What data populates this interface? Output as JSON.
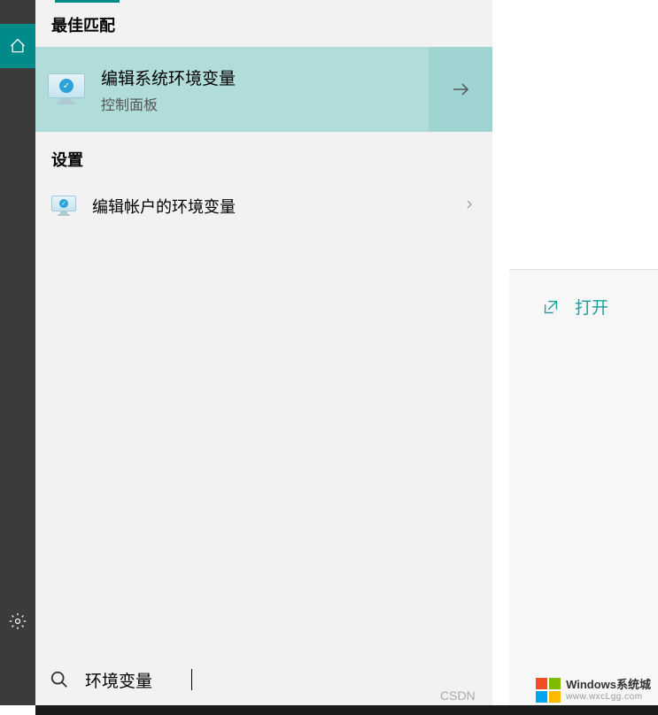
{
  "sidebar": {
    "home_icon": "home-icon",
    "settings_icon": "gear-icon"
  },
  "sections": {
    "best_match": "最佳匹配",
    "settings": "设置"
  },
  "best_match_result": {
    "title": "编辑系统环境变量",
    "subtitle": "控制面板"
  },
  "settings_result": {
    "title": "编辑帐户的环境变量"
  },
  "right_panel": {
    "open_label": "打开"
  },
  "search": {
    "query": "环境变量"
  },
  "csdn": "CSDN",
  "watermark": {
    "title": "Windows系统城",
    "url": "www.wxcLgg.com"
  }
}
